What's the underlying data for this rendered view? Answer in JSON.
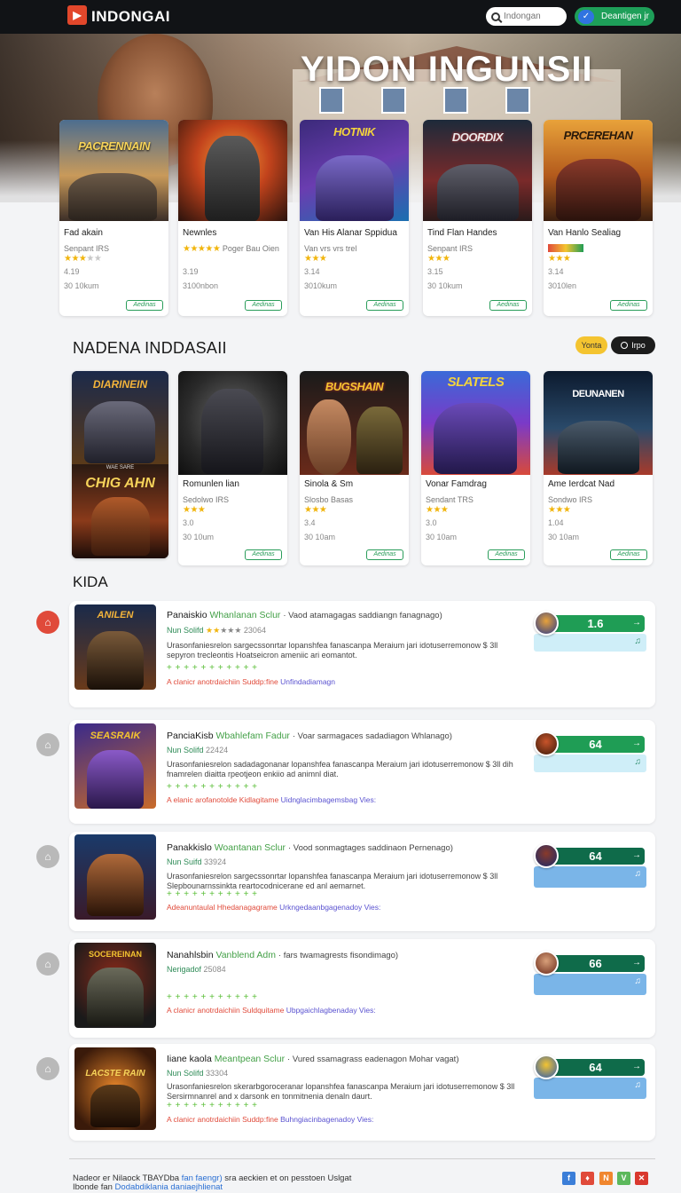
{
  "header": {
    "logo_text": "INDONGAI",
    "search_placeholder": "Indongan",
    "download_label": "Deantigen jr"
  },
  "hero": {
    "title": "YIDON INGUNSII"
  },
  "top_cards": [
    {
      "logo": "PACRENNAIN",
      "title": "Fad akain",
      "sub": "Senpant IRS",
      "stars": 3,
      "rating": "4.19",
      "size": "30 10kum",
      "cta": "Aedinas"
    },
    {
      "logo": "",
      "title": "Newnles",
      "sub": "Poger Bau Oien",
      "stars": 5,
      "rating": "3.19",
      "size": "3100nbon",
      "cta": "Aedinas"
    },
    {
      "logo": "HOTNIK",
      "title": "Van His Alanar Sppidua",
      "sub": "Van vrs vrs trel",
      "stars": 3,
      "rating": "3.14",
      "size": "3010kum",
      "cta": "Aedinas"
    },
    {
      "logo": "DOORDIX",
      "title": "Tind Flan Handes",
      "sub": "Senpant IRS",
      "stars": 3,
      "rating": "3.15",
      "size": "30 10kum",
      "cta": "Aedinas"
    },
    {
      "logo": "PRCEREHAN",
      "title": "Van Hanlo Sealiag",
      "sub": "",
      "stars": 3,
      "rating": "3.14",
      "size": "3010len",
      "cta": "Aedinas"
    }
  ],
  "section_title": "NADENA INDDASAII",
  "section_pill_yellow": "Yonta",
  "section_pill_dark": "Irpo",
  "tall_card": {
    "top_logo": "DIARINEIN",
    "bottom_logo": "CHIG AHN",
    "bottom_small": "WAE SARE"
  },
  "second_cards": [
    {
      "logo": "",
      "title": "Romunlen lian",
      "sub": "Sedolwo IRS",
      "stars": 3,
      "rating": "3.0",
      "size": "30 10um",
      "cta": "Aedinas"
    },
    {
      "logo": "BUGSHAIN",
      "title": "Sinola & Sm",
      "sub": "Slosbo Basas",
      "stars": 3,
      "rating": "3.4",
      "size": "30 10am",
      "cta": "Aedinas"
    },
    {
      "logo": "SLATELS",
      "title": "Vonar Famdrag",
      "sub": "Sendant TRS",
      "stars": 3,
      "rating": "3.0",
      "size": "30 10am",
      "cta": "Aedinas"
    },
    {
      "logo": "DEUNANEN",
      "title": "Ame Ierdcat Nad",
      "sub": "Sondwo IRS",
      "stars": 3,
      "rating": "1.04",
      "size": "30 10am",
      "cta": "Aedinas"
    }
  ],
  "list_title": "KIDA",
  "list": [
    {
      "rank_icon": "⌂",
      "logo": "ANILEN",
      "name": "Panaiskio",
      "name_green": "Whanlanan Sclur",
      "tagline": "· Vaod atamagagas saddiangn fanagnago)",
      "author": "Nun Solifd",
      "stars": 2,
      "count": "23064",
      "desc": "Urasonfaniesrelon sargecssonrtar lopanshfea fanascanpa Meraium jari idotuserremonow $ 3ll sepyron trecleontis Hoatseicron ameniic ari eomantot.",
      "green": "+ + + + + + + + + + +",
      "link_red": "A clanicr anotrdaichiin",
      "link_grey": "Suddp:fine",
      "link_purple": "Unfindadiamagn",
      "score": "1.6",
      "lower": "light",
      "bar": "green"
    },
    {
      "rank_icon": "⌂",
      "logo": "SEASRAIK",
      "name": "PanciaKisb",
      "name_green": "Wbahlefam Fadur",
      "tagline": "· Voar sarmagaces sadadiagon Whlanago)",
      "author": "Nun Solifd",
      "stars": 0,
      "count": "22424",
      "desc": "Urasonfaniesrelon sadadagonanar lopanshfea fanascanpa Meraium jari idotuserremonow $ 3ll dih fnamrelen diaitta rpeotjeon enkiio ad animnl diat.",
      "green": "+ + + + + + + + + + +",
      "link_red": "A elanic arofanotolde",
      "link_grey": "Kidlagitame",
      "link_purple": "Uidnglacimbagemsbag Vies:",
      "score": "64",
      "lower": "light",
      "bar": "green"
    },
    {
      "rank_icon": "⌂",
      "logo": "",
      "name": "Panakkislo",
      "name_green": "Woantanan Sclur",
      "tagline": "· Vood sonmagtages saddinaon Pernenago)",
      "author": "Nun Suifd",
      "stars": 0,
      "count": "33924",
      "desc": "Urasonfaniesrelon sargecssonrtar lopanshfea fanascanpa Meraium jari idotuserremonow $ 3ll Slepbounarnssinkta reartocodnicerane ed anl aemarnet.",
      "green": "+ + + + + + + + + + +",
      "link_red": "Adeanuntaulal",
      "link_grey": "Hhedanagagrame",
      "link_purple": "Urkngedaanbgagenadoy Vies:",
      "score": "64",
      "lower": "blue",
      "bar": "dark"
    },
    {
      "rank_icon": "⌂",
      "logo": "SOCEREINAN",
      "name": "Nanahlsbin",
      "name_green": "Vanblend Adm",
      "tagline": "· fars twamagrests fisondimago)",
      "author": "Nerigadof",
      "stars": 0,
      "count": "25084",
      "desc": "",
      "green": "+ + + + + + + + + + +",
      "link_red": "A clanicr anotrdaichiin",
      "link_grey": "Suldquitame",
      "link_purple": "Ubpgaichlagbenaday Vies:",
      "score": "66",
      "lower": "blue",
      "bar": "dark"
    },
    {
      "rank_icon": "⌂",
      "logo": "LACSTE RAIN",
      "name": "Iiane kaola",
      "name_green": "Meantpean Sclur",
      "tagline": "· Vured ssamagrass eadenagon Mohar vagat)",
      "author": "Nun Solifd",
      "stars": 0,
      "count": "33304",
      "desc": "Urasonfaniesrelon skerarbgoroceranar lopanshfea fanascanpa Meraium jari idotuserremonow $ 3ll Sersirmnanrel and x darsonk en tonmitnenia denaln daurt.",
      "green": "+ + + + + + + + + + +",
      "link_red": "A clanicr anotrdaichiin",
      "link_grey": "Suddp:fine",
      "link_purple": "Buhngiacinbagenadoy Vies:",
      "score": "64",
      "lower": "blue",
      "bar": "dark"
    }
  ],
  "footer": {
    "line1_a": "Nadeor er Nilaock TBAYDba",
    "line1_link": "fan faengr)",
    "line1_b": "sra aeckien et on pesstoen Uslgat",
    "line2_a": "Ibonde fan",
    "line2_link": "Dodabdiklania daniaejhlienat"
  },
  "social": [
    {
      "label": "f",
      "color": "#3b7ed8"
    },
    {
      "label": "♦",
      "color": "#e04a3a"
    },
    {
      "label": "N",
      "color": "#f0862e"
    },
    {
      "label": "V",
      "color": "#5cb85c"
    },
    {
      "label": "✕",
      "color": "#d9382e"
    }
  ]
}
